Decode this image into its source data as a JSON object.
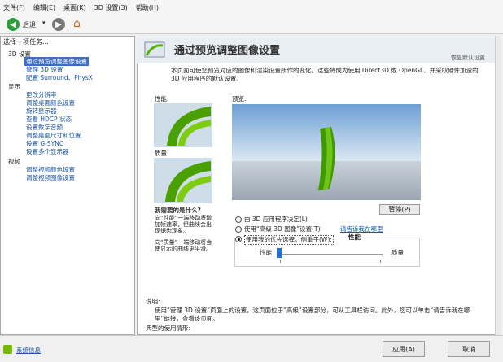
{
  "menu": [
    "文件(F)",
    "编辑(E)",
    "桌面(K)",
    "3D 设置(3)",
    "帮助(H)"
  ],
  "toolbar": {
    "back": "后退"
  },
  "sidebar": {
    "title": "选择一项任务...",
    "items": [
      "3D 设置",
      "通过预览调整图像设置",
      "管理 3D 设置",
      "配置 Surround、PhysX",
      "显示",
      "更改分辨率",
      "调整桌面颜色设置",
      "旋转显示器",
      "查看 HDCP 状态",
      "设置数字音频",
      "调整桌面尺寸和位置",
      "设置 G-SYNC",
      "设置多个显示器",
      "视频",
      "调整视频颜色设置",
      "调整视频图像设置"
    ]
  },
  "main": {
    "title": "通过预览调整图像设置",
    "restore": "恢复默认设置",
    "desc": "本页面可使您预览对应的图像和渲染设置所作的变化。这些将成为使用 Direct3D 或 OpenGL、并采取硬件加速的 3D 应用程序的默认设置。",
    "perf_label": "性能:",
    "quality_label": "质量:",
    "preview_label": "预览:",
    "need_title": "我需要的是什么?",
    "need1": "向“性能”一端移动将增加帧速率，但曲线会出现锯齿现象。",
    "need2": "向“质量”一端移动将会使显示的曲线更平滑。",
    "pause": "暂停(P)",
    "opt1": "由 3D 应用程序决定(L)",
    "opt2": "使用“高级 3D 图像”设置(T)",
    "opt2_link": "请告诉我在哪里",
    "opt3": "使用我的优先选择，侧重于(W):",
    "opt3_value": "性能",
    "slider_left": "性能",
    "slider_right": "质量",
    "slider_level": 0,
    "desc_title": "说明:",
    "desc_body": "使用“管理 3D 设置”页面上的设置。这页面位于“高级”设置部分，可从工具栏访问。此外，您可以单击“请告诉我在哪里”链接，查看该页面。",
    "typical": "典型的使用情形:"
  },
  "status": {
    "sysinfo": "系统信息",
    "apply": "应用(A)",
    "cancel": "取消"
  }
}
